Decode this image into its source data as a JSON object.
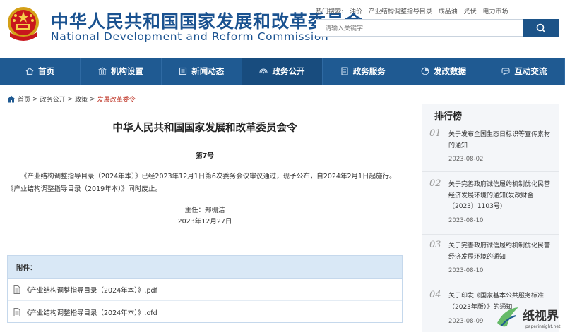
{
  "header": {
    "title_cn": "中华人民共和国国家发展和改革委员会",
    "title_en": "National Development and Reform Commission",
    "hot_label": "热门搜索:",
    "hot_terms": [
      "油价",
      "产业结构调整指导目录",
      "成品油",
      "光伏",
      "电力市场"
    ],
    "search_placeholder": "请输入关键字"
  },
  "nav": {
    "items": [
      {
        "label": "首页",
        "icon": "home-icon"
      },
      {
        "label": "机构设置",
        "icon": "building-icon"
      },
      {
        "label": "新闻动态",
        "icon": "news-icon"
      },
      {
        "label": "政务公开",
        "icon": "broadcast-icon",
        "active": true
      },
      {
        "label": "政务服务",
        "icon": "document-icon"
      },
      {
        "label": "发改数据",
        "icon": "pie-chart-icon"
      },
      {
        "label": "互动交流",
        "icon": "chat-icon"
      }
    ]
  },
  "breadcrumb": {
    "items": [
      "首页",
      "政务公开",
      "政策"
    ],
    "current": "发展改革委令",
    "separator": ">"
  },
  "article": {
    "title": "中华人民共和国国家发展和改革委员会令",
    "number": "第7号",
    "body": "《产业结构调整指导目录（2024年本）》已经2023年12月1日第6次委务会议审议通过，现予公布，自2024年2月1日起施行。《产业结构调整指导目录（2019年本）》同时废止。",
    "signer": "主任：郑栅洁",
    "date": "2023年12月27日"
  },
  "attachments": {
    "header": "附件：",
    "files": [
      "《产业结构调整指导目录（2024年本）》.pdf",
      "《产业结构调整指导目录（2024年本）》.ofd"
    ]
  },
  "ranking": {
    "title": "排行榜",
    "items": [
      {
        "num": "01",
        "title": "关于发布全国生态日标识等宣传素材的通知",
        "date": "2023-08-02"
      },
      {
        "num": "02",
        "title": "关于完善政府诚信履约机制优化民营经济发展环境的通知(发改财金〔2023〕1103号)",
        "date": "2023-08-10"
      },
      {
        "num": "03",
        "title": "关于完善政府诚信履约机制优化民营经济发展环境的通知",
        "date": "2023-08-10"
      },
      {
        "num": "04",
        "title": "关于印发《国家基本公共服务标准（2023年版）》的通知",
        "date": "2023-08-09"
      }
    ]
  },
  "watermark": {
    "text": "纸视界",
    "sub": "paperinsight.net"
  },
  "colors": {
    "brand_blue": "#1a5290",
    "nav_bg": "#1f5a92",
    "breadcrumb_current": "#c0392b",
    "attach_head_bg": "#d9e8f6"
  }
}
